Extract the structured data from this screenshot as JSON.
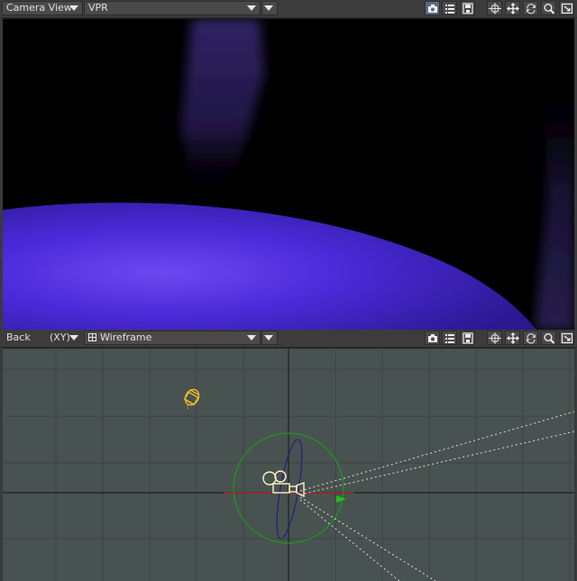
{
  "top_viewport": {
    "view_label": "Camera View",
    "render_mode": "VPR",
    "icons": [
      "camera-icon",
      "list-icon",
      "save-icon",
      "pan-icon",
      "move-icon",
      "rotate-icon",
      "zoom-icon",
      "maximize-icon"
    ]
  },
  "bottom_viewport": {
    "view_label": "Back",
    "axis_label": "(XY)",
    "render_mode": "Wireframe",
    "icons": [
      "camera-icon",
      "list-icon",
      "save-icon",
      "pan-icon",
      "move-icon",
      "rotate-icon",
      "zoom-icon",
      "maximize-icon"
    ]
  },
  "colors": {
    "render_background": "#000000",
    "render_sphere": "#4a2ad8",
    "wireframe_background": "#485250",
    "grid": "#3b4442",
    "axis": "#1d2020",
    "light_wireframe": "#ffc020",
    "camera_wireframe": "#fff2c0",
    "selection_circle": "#1a9c1a",
    "gizmo_ring": "#202080",
    "x_axis": "#b02020",
    "y_axis": "#20c020"
  }
}
